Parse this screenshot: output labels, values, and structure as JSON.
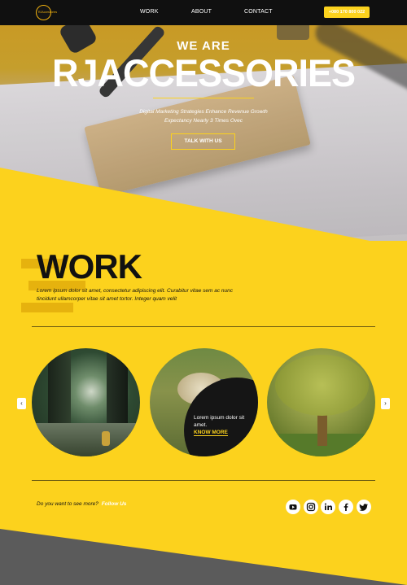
{
  "brand": {
    "logo_text": "RJAccessories"
  },
  "nav": {
    "links": [
      "WORK",
      "ABOUT",
      "CONTACT"
    ],
    "phone": "+080 170 800 022"
  },
  "hero": {
    "kicker": "WE ARE",
    "title": "RJACCESSORIES",
    "subtitle_line1": "Digital Marketing Strategies Enhance Revenue Growth",
    "subtitle_line2": "Expectancy Nearly 3 Times Ovec",
    "cta": "TALK WITH US"
  },
  "work": {
    "title": "WORK",
    "description": "Lorem ipsum dolor sit amet, consectetur adipiscing elit. Curabitur vitae sem ac nunc tincidunt ullamcorper vitae sit amet tortor. Integer quam velit",
    "card_text": "Lorem ipsum dolor sit amet.",
    "card_link": "KNOW MORE",
    "prev_arrow": "‹",
    "next_arrow": "›"
  },
  "footer": {
    "question": "Do you want to see more?",
    "follow": "Follow Us",
    "social_icons": [
      "youtube-icon",
      "instagram-icon",
      "linkedin-icon",
      "facebook-icon",
      "twitter-icon"
    ]
  },
  "colors": {
    "accent": "#fcd21d",
    "dark": "#101010",
    "gray": "#5b5b5b"
  }
}
